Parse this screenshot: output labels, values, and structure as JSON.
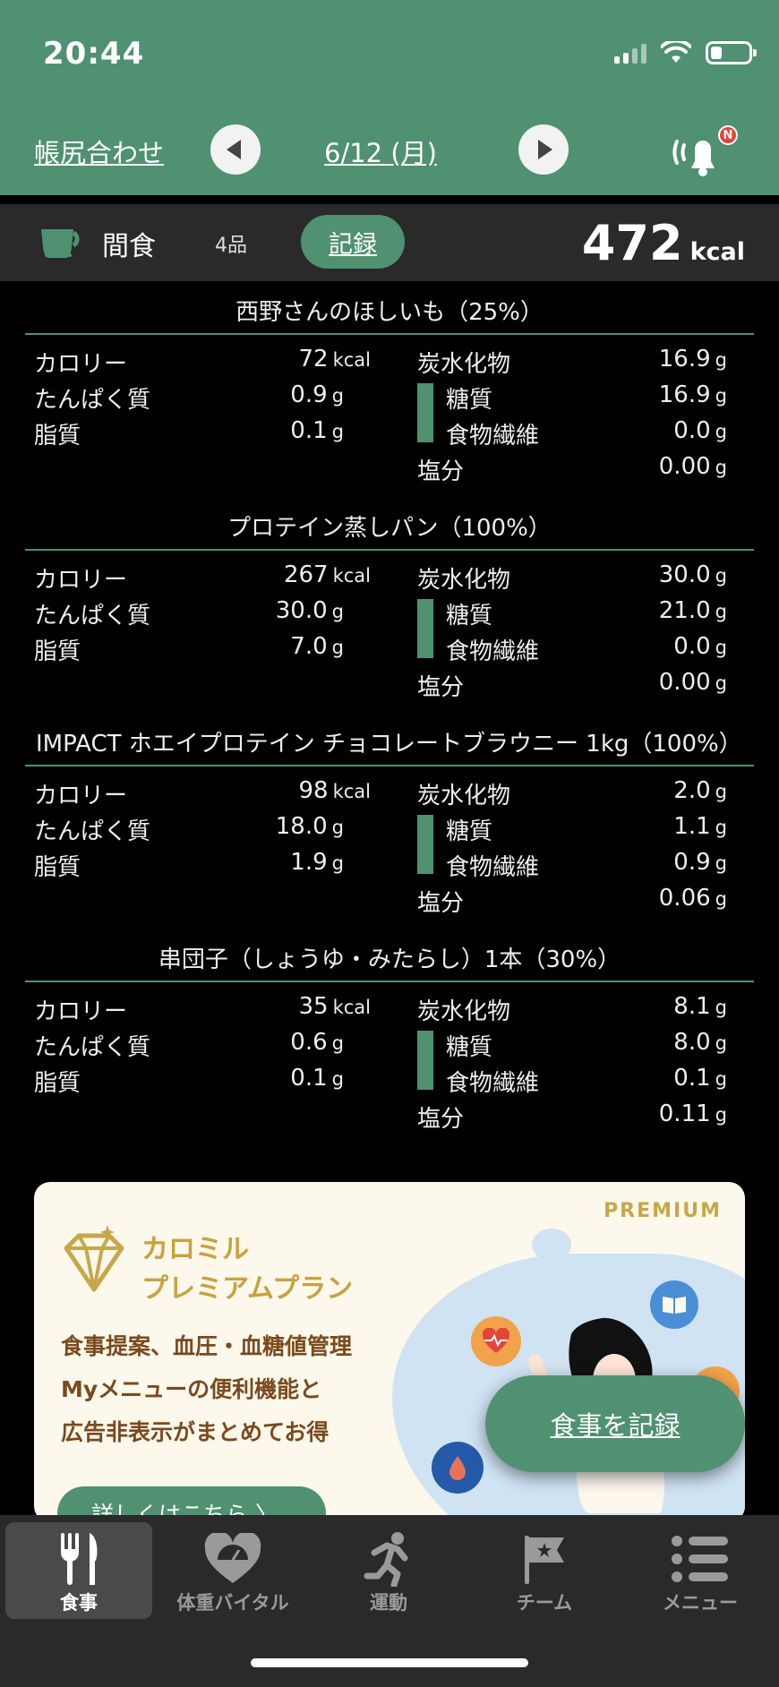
{
  "status": {
    "time": "20:44"
  },
  "header": {
    "left_link": "帳尻合わせ",
    "date": "6/12 (月)",
    "bell_badge": "N"
  },
  "meal": {
    "name": "間食",
    "count": "4品",
    "record_label": "記録",
    "total_kcal": "472",
    "kcal_unit": "kcal"
  },
  "labels": {
    "calorie": "カロリー",
    "protein": "たんぱく質",
    "fat": "脂質",
    "carbs": "炭水化物",
    "sugar": "糖質",
    "fiber": "食物繊維",
    "salt": "塩分",
    "kcal": "kcal",
    "g": "g"
  },
  "foods": [
    {
      "title": "西野さんのほしいも（25%）",
      "kcal": "72",
      "protein": "0.9",
      "fat": "0.1",
      "carbs": "16.9",
      "sugar": "16.9",
      "fiber": "0.0",
      "salt": "0.00"
    },
    {
      "title": "プロテイン蒸しパン（100%）",
      "kcal": "267",
      "protein": "30.0",
      "fat": "7.0",
      "carbs": "30.0",
      "sugar": "21.0",
      "fiber": "0.0",
      "salt": "0.00"
    },
    {
      "title": "IMPACT ホエイプロテイン チョコレートブラウニー 1kg（100%）",
      "kcal": "98",
      "protein": "18.0",
      "fat": "1.9",
      "carbs": "2.0",
      "sugar": "1.1",
      "fiber": "0.9",
      "salt": "0.06"
    },
    {
      "title": "串団子（しょうゆ・みたらし）1本（30%）",
      "kcal": "35",
      "protein": "0.6",
      "fat": "0.1",
      "carbs": "8.1",
      "sugar": "8.0",
      "fiber": "0.1",
      "salt": "0.11"
    }
  ],
  "promo": {
    "badge": "PREMIUM",
    "title_line1": "カロミル",
    "title_line2": "プレミアムプラン",
    "desc_line1": "食事提案、血圧・血糖値管理",
    "desc_line2": "Myメニューの便利機能と",
    "desc_line3": "広告非表示がまとめてお得",
    "more_label": "詳しくはこちら 〉"
  },
  "fab": {
    "label": "食事を記録"
  },
  "tabs": [
    {
      "label": "食事",
      "icon": "fork-knife-icon",
      "active": true
    },
    {
      "label": "体重バイタル",
      "icon": "heart-scale-icon",
      "active": false
    },
    {
      "label": "運動",
      "icon": "runner-icon",
      "active": false
    },
    {
      "label": "チーム",
      "icon": "flag-icon",
      "active": false
    },
    {
      "label": "メニュー",
      "icon": "menu-list-icon",
      "active": false
    }
  ],
  "colors": {
    "accent": "#4f9170",
    "header_bg": "#4f9170",
    "bar_bg": "#2a2a2a",
    "badge": "#e2453a",
    "premium_gold": "#c8a74a"
  }
}
